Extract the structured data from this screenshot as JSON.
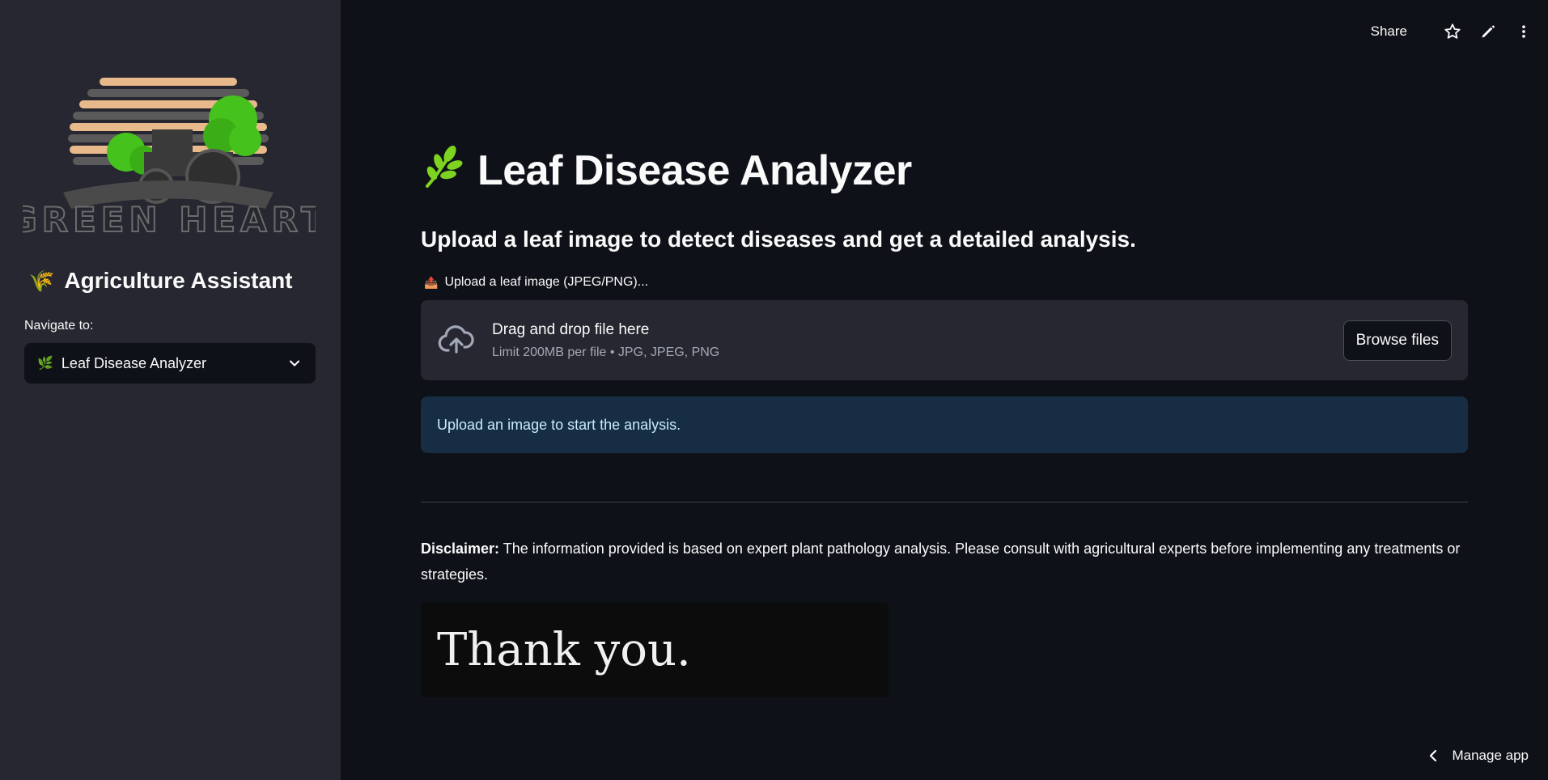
{
  "sidebar": {
    "logo_text": "GREEN HEART",
    "title_emoji": "🌾",
    "title": "Agriculture Assistant",
    "nav_label": "Navigate to:",
    "select_icon": "🌿",
    "select_value": "Leaf Disease Analyzer"
  },
  "toolbar": {
    "share_label": "Share",
    "icons": [
      "star-icon",
      "pencil-icon",
      "more-vertical-icon"
    ]
  },
  "main": {
    "title_emoji": "🌿",
    "title": "Leaf Disease Analyzer",
    "subtitle": "Upload a leaf image to detect diseases and get a detailed analysis.",
    "upload_emoji": "📤",
    "upload_label": "Upload a leaf image (JPEG/PNG)...",
    "dropzone_main": "Drag and drop file here",
    "dropzone_sub": "Limit 200MB per file • JPG, JPEG, PNG",
    "browse_label": "Browse files",
    "info_text": "Upload an image to start the analysis.",
    "disclaimer_bold": "Disclaimer:",
    "disclaimer_text": " The information provided is based on expert plant pathology analysis. Please consult with agricultural experts before implementing any treatments or strategies.",
    "thanks_text": "Thank you."
  },
  "footer": {
    "manage_label": "Manage app"
  },
  "colors": {
    "background": "#0e1117",
    "sidebar": "#262730",
    "info_bg": "#172d43",
    "info_text": "#c7ebff",
    "leaf_green": "#7ed321"
  }
}
